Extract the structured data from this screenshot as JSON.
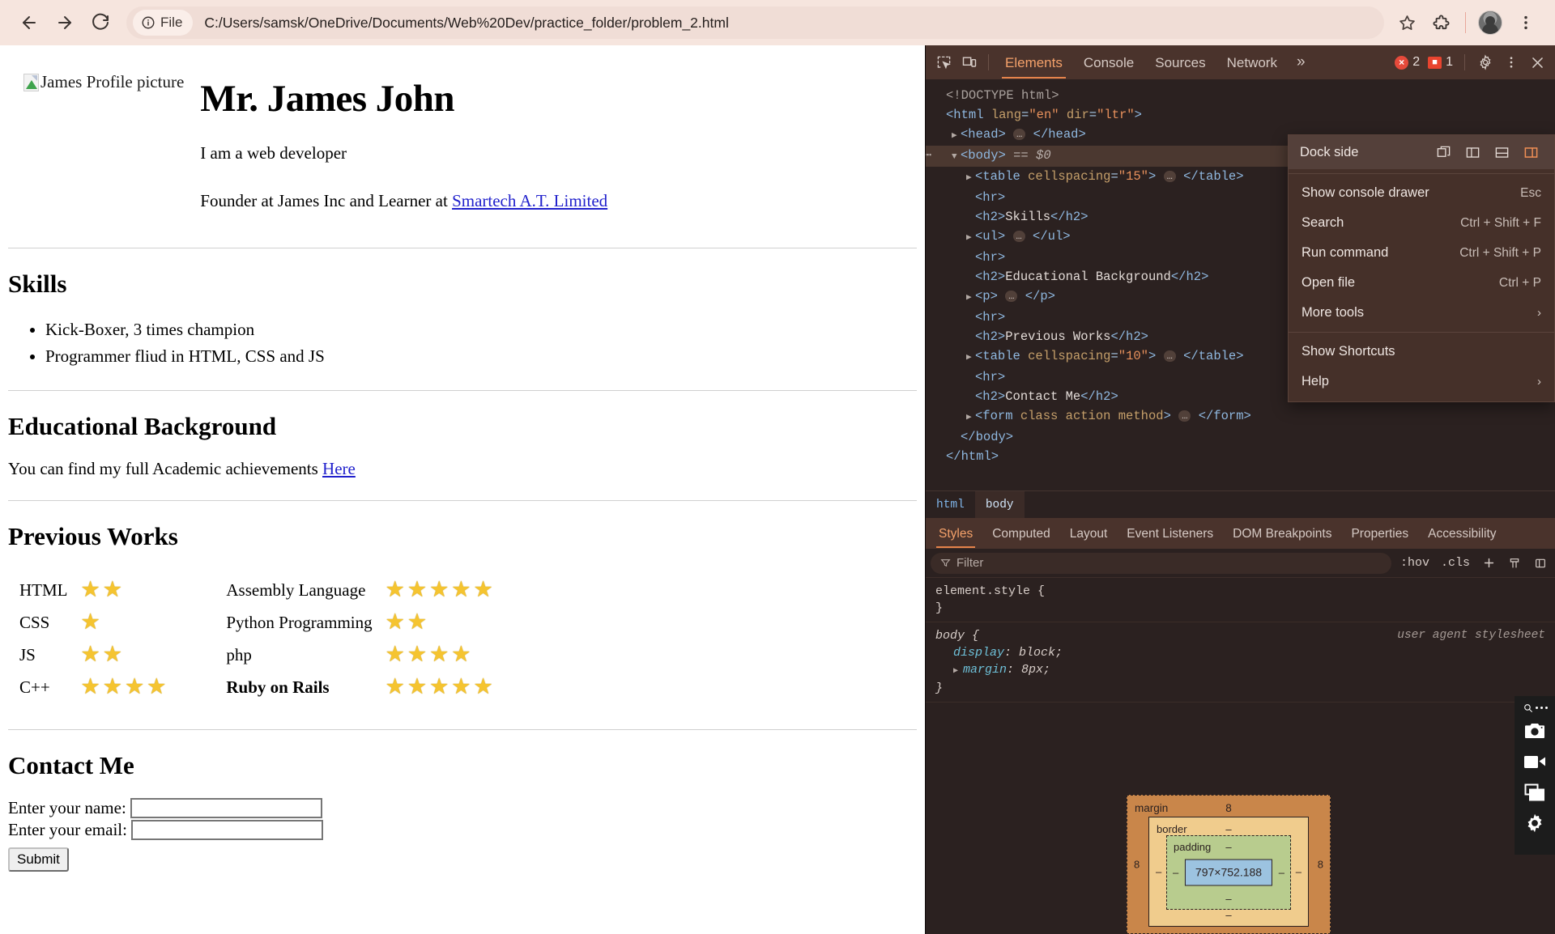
{
  "browser": {
    "back_label": "Back",
    "forward_label": "Forward",
    "reload_label": "Reload",
    "file_chip_label": "File",
    "url": "C:/Users/samsk/OneDrive/Documents/Web%20Dev/practice_folder/problem_2.html",
    "bookmark_label": "Bookmark this tab",
    "extensions_label": "Extensions",
    "profile_label": "Profile",
    "menu_label": "Customize and control Google Chrome"
  },
  "page": {
    "profile_image_alt": "James Profile picture",
    "name": "Mr. James John",
    "tagline_1": "I am a web developer",
    "tagline_2_prefix": "Founder at James Inc and Learner at ",
    "tagline_2_link": "Smartech A.T. Limited",
    "skills_heading": "Skills",
    "skills": [
      "Kick-Boxer, 3 times champion",
      "Programmer fliud in HTML, CSS and JS"
    ],
    "education_heading": "Educational Background",
    "education_text_prefix": "You can find my full Academic achievements ",
    "education_link": "Here",
    "works_heading": "Previous Works",
    "works": [
      {
        "left_label": "HTML",
        "left_stars": 2,
        "right_label": "Assembly Language",
        "right_stars": 5,
        "right_bold": false
      },
      {
        "left_label": "CSS",
        "left_stars": 1,
        "right_label": "Python Programming",
        "right_stars": 2,
        "right_bold": false
      },
      {
        "left_label": "JS",
        "left_stars": 2,
        "right_label": "php",
        "right_stars": 4,
        "right_bold": false
      },
      {
        "left_label": "C++",
        "left_stars": 4,
        "right_label": "Ruby on Rails",
        "right_stars": 5,
        "right_bold": true
      }
    ],
    "star_glyph": "★",
    "star_color": "#f5c430",
    "contact_heading": "Contact Me",
    "form": {
      "name_label": "Enter your name:",
      "name_value": "",
      "email_label": "Enter your email:",
      "email_value": "",
      "submit_label": "Submit"
    }
  },
  "devtools": {
    "inspect_icon_label": "Inspect element",
    "device_icon_label": "Toggle device toolbar",
    "tabs": [
      "Elements",
      "Console",
      "Sources",
      "Network"
    ],
    "active_tab": "Elements",
    "more_tabs_glyph": "»",
    "error_count": "2",
    "warning_count": "1",
    "settings_label": "Settings",
    "kebab_label": "Customize and control DevTools",
    "close_label": "Close DevTools",
    "dom_lines": [
      {
        "indent": 0,
        "arrow": "",
        "html": "<span class=\"doctype\">&lt;!DOCTYPE html&gt;</span>",
        "selected": false
      },
      {
        "indent": 0,
        "arrow": "",
        "html": "<span class=\"tag\">&lt;html</span> <span class=\"attr\">lang</span>=<span class=\"val\">\"en\"</span> <span class=\"attr\">dir</span>=<span class=\"val\">\"ltr\"</span><span class=\"tag\">&gt;</span>",
        "selected": false
      },
      {
        "indent": 1,
        "arrow": "▶",
        "html": "<span class=\"tag\">&lt;head&gt;</span> <span class=\"dots\">…</span> <span class=\"tag\">&lt;/head&gt;</span>",
        "selected": false
      },
      {
        "indent": 1,
        "arrow": "▼",
        "html": "<span class=\"tag\">&lt;body&gt;</span> <span class=\"dollar\">== $0</span>",
        "selected": true
      },
      {
        "indent": 2,
        "arrow": "▶",
        "html": "<span class=\"tag\">&lt;table</span> <span class=\"attr\">cellspacing</span>=<span class=\"val\">\"15\"</span><span class=\"tag\">&gt;</span> <span class=\"dots\">…</span> <span class=\"tag\">&lt;/table&gt;</span>",
        "selected": false
      },
      {
        "indent": 2,
        "arrow": "",
        "html": "<span class=\"tag\">&lt;hr&gt;</span>",
        "selected": false
      },
      {
        "indent": 2,
        "arrow": "",
        "html": "<span class=\"tag\">&lt;h2&gt;</span><span class=\"txt\">Skills</span><span class=\"tag\">&lt;/h2&gt;</span>",
        "selected": false
      },
      {
        "indent": 2,
        "arrow": "▶",
        "html": "<span class=\"tag\">&lt;ul&gt;</span> <span class=\"dots\">…</span> <span class=\"tag\">&lt;/ul&gt;</span>",
        "selected": false
      },
      {
        "indent": 2,
        "arrow": "",
        "html": "<span class=\"tag\">&lt;hr&gt;</span>",
        "selected": false
      },
      {
        "indent": 2,
        "arrow": "",
        "html": "<span class=\"tag\">&lt;h2&gt;</span><span class=\"txt\">Educational Background</span><span class=\"tag\">&lt;/h2&gt;</span>",
        "selected": false
      },
      {
        "indent": 2,
        "arrow": "▶",
        "html": "<span class=\"tag\">&lt;p&gt;</span> <span class=\"dots\">…</span> <span class=\"tag\">&lt;/p&gt;</span>",
        "selected": false
      },
      {
        "indent": 2,
        "arrow": "",
        "html": "<span class=\"tag\">&lt;hr&gt;</span>",
        "selected": false
      },
      {
        "indent": 2,
        "arrow": "",
        "html": "<span class=\"tag\">&lt;h2&gt;</span><span class=\"txt\">Previous Works</span><span class=\"tag\">&lt;/h2&gt;</span>",
        "selected": false
      },
      {
        "indent": 2,
        "arrow": "▶",
        "html": "<span class=\"tag\">&lt;table</span> <span class=\"attr\">cellspacing</span>=<span class=\"val\">\"10\"</span><span class=\"tag\">&gt;</span> <span class=\"dots\">…</span> <span class=\"tag\">&lt;/table&gt;</span>",
        "selected": false
      },
      {
        "indent": 2,
        "arrow": "",
        "html": "<span class=\"tag\">&lt;hr&gt;</span>",
        "selected": false
      },
      {
        "indent": 2,
        "arrow": "",
        "html": "<span class=\"tag\">&lt;h2&gt;</span><span class=\"txt\">Contact Me</span><span class=\"tag\">&lt;/h2&gt;</span>",
        "selected": false
      },
      {
        "indent": 2,
        "arrow": "▶",
        "html": "<span class=\"tag\">&lt;form</span> <span class=\"attr\">class action method</span><span class=\"tag\">&gt;</span> <span class=\"dots\">…</span> <span class=\"tag\">&lt;/form&gt;</span>",
        "selected": false
      },
      {
        "indent": 1,
        "arrow": "",
        "html": "<span class=\"tag\">&lt;/body&gt;</span>",
        "selected": false
      },
      {
        "indent": 0,
        "arrow": "",
        "html": "<span class=\"tag\">&lt;/html&gt;</span>",
        "selected": false
      }
    ],
    "breadcrumb": [
      "html",
      "body"
    ],
    "breadcrumb_active": "body",
    "style_tabs": [
      "Styles",
      "Computed",
      "Layout",
      "Event Listeners",
      "DOM Breakpoints",
      "Properties",
      "Accessibility"
    ],
    "style_active_tab": "Styles",
    "filter_placeholder": "Filter",
    "filter_value": "",
    "hov_label": ":hov",
    "cls_label": ".cls",
    "add_rule_label": "New Style Rule",
    "rules": [
      {
        "selector": "element.style {",
        "close": "}",
        "source": "",
        "declarations": []
      },
      {
        "selector": "body {",
        "close": "}",
        "source": "user agent stylesheet",
        "declarations": [
          {
            "prop": "display",
            "value": "block;",
            "expand": false
          },
          {
            "prop": "margin",
            "value": "8px;",
            "expand": true
          }
        ]
      }
    ],
    "box_model": {
      "margin_label": "margin",
      "border_label": "border",
      "padding_label": "padding",
      "content_size": "797×752.188",
      "margin_top": "8",
      "margin_right": "8",
      "margin_bottom": "8",
      "margin_left": "8",
      "border_top": "–",
      "border_right": "–",
      "border_bottom": "–",
      "border_left": "–",
      "padding_top": "–",
      "padding_right": "–",
      "padding_bottom": "–",
      "padding_left": "–"
    },
    "dock_menu": {
      "dock_side_label": "Dock side",
      "dock_options": [
        "undock",
        "dock-left",
        "dock-bottom",
        "dock-right"
      ],
      "dock_active": "dock-right",
      "items": [
        {
          "label": "Show console drawer",
          "key": "Esc",
          "chevron": false
        },
        {
          "label": "Search",
          "key": "Ctrl + Shift + F",
          "chevron": false
        },
        {
          "label": "Run command",
          "key": "Ctrl + Shift + P",
          "chevron": false
        },
        {
          "label": "Open file",
          "key": "Ctrl + P",
          "chevron": false
        },
        {
          "label": "More tools",
          "key": "",
          "chevron": true
        }
      ],
      "items2": [
        {
          "label": "Show Shortcuts",
          "key": "",
          "chevron": false
        },
        {
          "label": "Help",
          "key": "",
          "chevron": true
        }
      ]
    }
  },
  "recorder": {
    "drag_label": "Drag toolbar",
    "screenshot_label": "Take screenshot",
    "record_label": "Record video",
    "window_label": "Capture window",
    "settings_label": "Recorder settings"
  },
  "colors": {
    "chrome_bg": "#f6e5de",
    "devtools_bg": "#2b2120",
    "devtools_toolbar": "#4a332c",
    "accent": "#e5834b",
    "error": "#e64a3b",
    "link": "#2020cc"
  }
}
